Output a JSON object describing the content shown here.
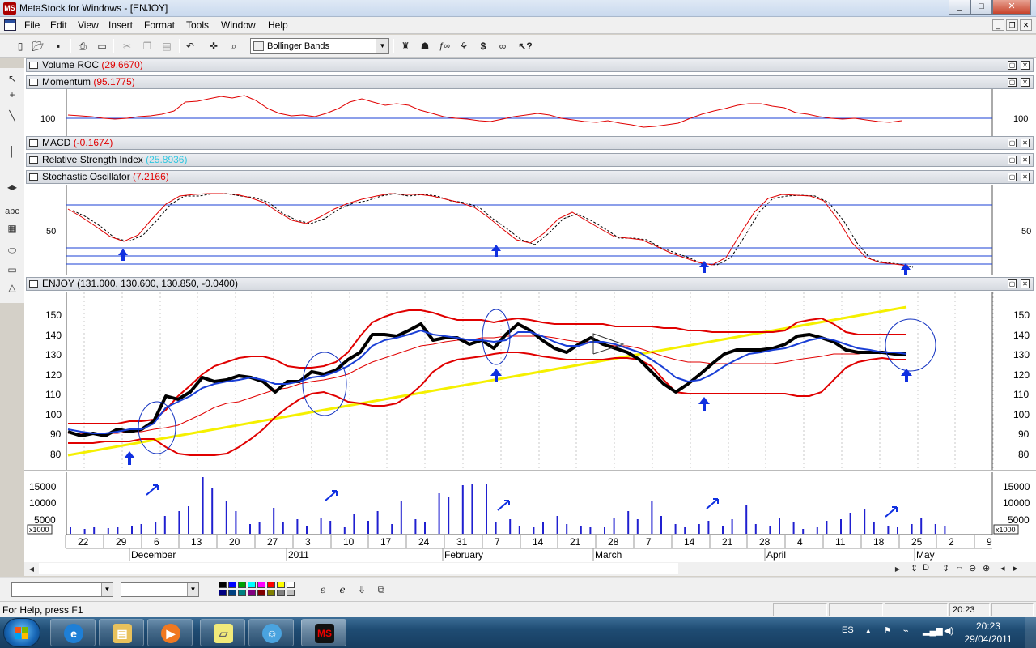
{
  "window": {
    "title": "MetaStock for Windows - [ENJOY]",
    "app_icon_text": "MS",
    "controls": [
      "_",
      "□",
      "✕"
    ]
  },
  "menu": [
    "File",
    "Edit",
    "View",
    "Insert",
    "Format",
    "Tools",
    "Window",
    "Help"
  ],
  "toolbar": {
    "indicator_select": "Bollinger Bands",
    "icons": [
      "new-icon",
      "open-icon",
      "save-icon",
      "print-icon",
      "print-preview-icon",
      "cut-icon",
      "copy-icon",
      "paste-icon",
      "undo-icon",
      "crosshair-icon",
      "zoom-icon",
      "expert-icon",
      "explorer-icon",
      "formula-icon",
      "system-tester-icon",
      "dollar-icon",
      "binoculars-icon",
      "help-pointer-icon"
    ]
  },
  "left_tools": [
    "arrow-icon",
    "cross-icon",
    "line-icon",
    "vertical-line-icon",
    "horizontal-scroll-icon",
    "text-icon",
    "grid-icon",
    "ellipse-icon",
    "rectangle-icon",
    "triangle-icon"
  ],
  "left_tool_text": {
    "text_tool": "abc"
  },
  "panes": {
    "volume_roc": {
      "name": "Volume ROC",
      "value": "(29.6670)"
    },
    "momentum": {
      "name": "Momentum",
      "value": "(95.1775)"
    },
    "macd": {
      "name": "MACD",
      "value": "(-0.1674)"
    },
    "rsi": {
      "name": "Relative Strength Index",
      "value": "(25.8936)"
    },
    "stochastic": {
      "name": "Stochastic Oscillator",
      "value": "(7.2166)"
    },
    "price": {
      "name": "ENJOY",
      "value": "(131.000, 130.600, 130.850, -0.0400)"
    }
  },
  "axis_labels": {
    "momentum": "100",
    "stochastic": "50",
    "price": [
      "150",
      "140",
      "130",
      "120",
      "110",
      "100",
      "90",
      "80"
    ],
    "volume": [
      "15000",
      "10000",
      "5000"
    ],
    "volume_unit": "x1000"
  },
  "dates": {
    "days": [
      "22",
      "29",
      "6",
      "13",
      "20",
      "27",
      "3",
      "10",
      "17",
      "24",
      "31",
      "7",
      "14",
      "21",
      "28",
      "7",
      "14",
      "21",
      "28",
      "4",
      "11",
      "18",
      "25",
      "2",
      "9"
    ],
    "months": [
      "December",
      "2011",
      "February",
      "March",
      "April",
      "May"
    ]
  },
  "status": {
    "help": "For Help, press F1",
    "time": "20:23"
  },
  "taskbar": {
    "lang": "ES",
    "clock_time": "20:23",
    "clock_date": "29/04/2011",
    "apps": [
      "internet-explorer-icon",
      "file-explorer-icon",
      "media-player-icon",
      "sticky-notes-icon",
      "messenger-icon",
      "metastock-icon"
    ],
    "metastock_label": "MS"
  },
  "colors": {
    "price_line": "#000000",
    "moving_average": "#1a3fd6",
    "bollinger_bands": "#e00000",
    "trendline": "#f5f000",
    "arrows": "#1030e0",
    "volume_bars": "#2020d0"
  }
}
